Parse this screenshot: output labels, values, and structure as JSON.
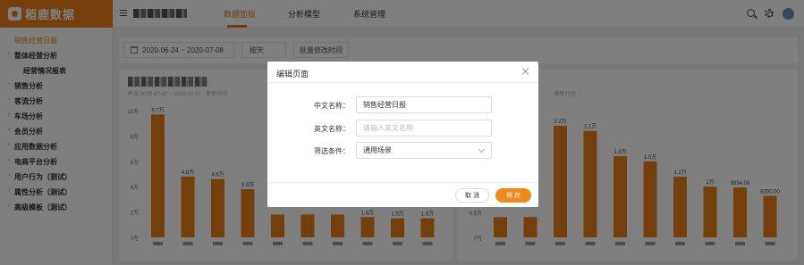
{
  "app": {
    "logo_text": "稻鹿数据"
  },
  "nav": {
    "tabs": [
      {
        "label": "数据面板",
        "active": true
      },
      {
        "label": "分析模型",
        "active": false
      },
      {
        "label": "系统管理",
        "active": false
      }
    ]
  },
  "sidebar": {
    "items": [
      {
        "label": "销售经营日报",
        "active": true,
        "has_arrow": false,
        "sub": false
      },
      {
        "label": "整体经营分析",
        "has_arrow": true,
        "sub": false
      },
      {
        "label": "经营情况报表",
        "has_arrow": false,
        "sub": true
      },
      {
        "label": "销售分析",
        "has_arrow": true,
        "sub": false
      },
      {
        "label": "客流分析",
        "has_arrow": true,
        "sub": false
      },
      {
        "label": "车场分析",
        "has_arrow": true,
        "sub": false
      },
      {
        "label": "会员分析",
        "has_arrow": true,
        "sub": false
      },
      {
        "label": "应用数据分析",
        "has_arrow": true,
        "sub": false
      },
      {
        "label": "电商平台分析",
        "has_arrow": true,
        "sub": false
      },
      {
        "label": "用户行为（测试）",
        "has_arrow": true,
        "sub": false
      },
      {
        "label": "属性分析（测试）",
        "has_arrow": true,
        "sub": false
      },
      {
        "label": "高级模板（测试）",
        "has_arrow": true,
        "sub": false
      }
    ]
  },
  "filters": {
    "date_range": "2020-06-24 ~ 2020-07-08",
    "unit": "按天",
    "batch_button": "批量修改时间"
  },
  "panels": {
    "left_sub": "昨日 2020-07-07 ~ 2020-07-07 · 更新时间 ·",
    "right_sub": "· 更新时间 ·"
  },
  "modal": {
    "title": "编辑页面",
    "cn_name_label": "中文名称：",
    "cn_name_value": "销售经营日报",
    "en_name_label": "英文名称：",
    "en_name_placeholder": "请输入英文名称",
    "filter_label": "筛选条件：",
    "filter_value": "通用场景",
    "cancel_label": "取 消",
    "save_label": "保 存"
  },
  "colors": {
    "accent": "#e87e17",
    "bar": "#e87e17"
  },
  "chart_data": [
    {
      "type": "bar",
      "title": "",
      "y_ticks": [
        "10万",
        "8万",
        "6万",
        "4万",
        "2万",
        "0万"
      ],
      "ylim": [
        0,
        100000
      ],
      "values": [
        97000,
        48000,
        46000,
        38000,
        18000,
        18000,
        18000,
        16000,
        15000,
        15000
      ],
      "data_labels": [
        "9.7万",
        "4.8万",
        "4.6万",
        "3.8万",
        "",
        "",
        "",
        "1.6万",
        "1.5万",
        "1.5万"
      ]
    },
    {
      "type": "bar",
      "title": "",
      "y_ticks": [
        "0.5万",
        "0万"
      ],
      "ylim": [
        0,
        25000
      ],
      "values": [
        4000,
        4000,
        22000,
        21000,
        16000,
        15000,
        12000,
        10000,
        9834,
        8200
      ],
      "data_labels": [
        "",
        "",
        "2.2万",
        "2.1万",
        "1.6万",
        "1.5万",
        "1.2万",
        "1万",
        "9834.00",
        "8200.00"
      ]
    }
  ]
}
